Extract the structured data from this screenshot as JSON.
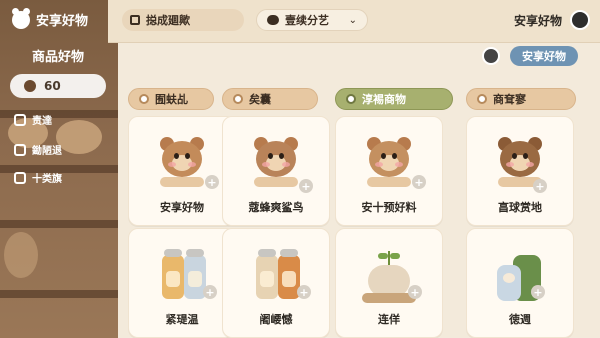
{
  "app": {
    "brand": "安享好物",
    "section_title": "商品好物",
    "count": "60"
  },
  "sidebar": {
    "items": [
      {
        "label": "责達",
        "icon": "box-icon"
      },
      {
        "label": "鋤陋退",
        "icon": "box-icon"
      },
      {
        "label": "十类旗",
        "icon": "box-icon"
      }
    ]
  },
  "topbar": {
    "search_text": "搃成廽歟",
    "menu_text": "壹续分艺",
    "user_name": "安享好物"
  },
  "subheader": {
    "pill_text": "安享好物"
  },
  "categories": [
    {
      "label": "囿蚨乩",
      "style": "tan"
    },
    {
      "label": "矣囊",
      "style": "tan"
    },
    {
      "label": "淳裼商物",
      "style": "green"
    },
    {
      "label": "商耷寥",
      "style": "tan"
    }
  ],
  "products": [
    {
      "title": "安享好物",
      "kind": "character"
    },
    {
      "title": "蔻蜂爽鲨鸟",
      "kind": "character"
    },
    {
      "title": "安十预好料",
      "kind": "character"
    },
    {
      "title": "亯球赏地",
      "kind": "character"
    },
    {
      "title": "紧瑅温",
      "kind": "jars"
    },
    {
      "title": "阇崾憾",
      "kind": "jars"
    },
    {
      "title": "连佯",
      "kind": "pot"
    },
    {
      "title": "徳週",
      "kind": "jars2"
    }
  ],
  "colors": {
    "bg": "#f3eadb",
    "accent_green": "#a7b06f",
    "accent_blue": "#6e93b3"
  }
}
